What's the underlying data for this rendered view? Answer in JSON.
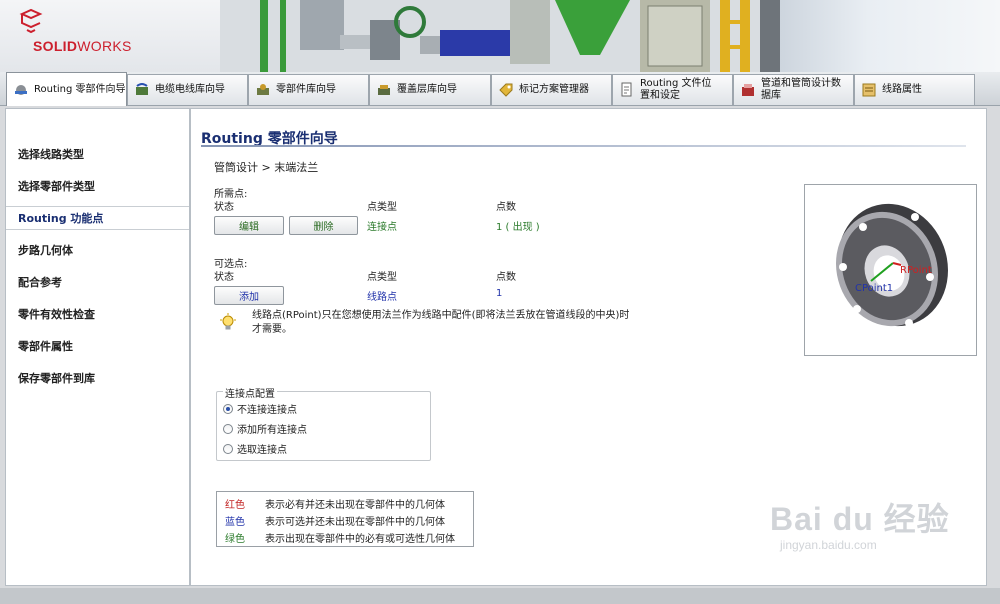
{
  "logo": {
    "brand_bold": "SOLID",
    "brand_light": "WORKS"
  },
  "tabs": [
    {
      "label": "Routing 零部件向导",
      "icon": "wizard-icon"
    },
    {
      "label": "电缆电线库向导",
      "icon": "cable-icon"
    },
    {
      "label": "零部件库向导",
      "icon": "component-icon"
    },
    {
      "label": "覆盖层库向导",
      "icon": "covering-icon"
    },
    {
      "label": "标记方案管理器",
      "icon": "tag-icon"
    },
    {
      "label": "Routing 文件位置和设定",
      "icon": "file-settings-icon"
    },
    {
      "label": "管道和管筒设计数据库",
      "icon": "database-icon"
    },
    {
      "label": "线路属性",
      "icon": "properties-icon"
    }
  ],
  "sidebar": {
    "items": [
      {
        "label": "选择线路类型"
      },
      {
        "label": "选择零部件类型"
      },
      {
        "label": "Routing 功能点"
      },
      {
        "label": "步路几何体"
      },
      {
        "label": "配合参考"
      },
      {
        "label": "零件有效性检查"
      },
      {
        "label": "零部件属性"
      },
      {
        "label": "保存零部件到库"
      }
    ]
  },
  "main": {
    "title": "Routing 零部件向导",
    "breadcrumb": "管筒设计 > 末端法兰",
    "required": {
      "section_label": "所需点:",
      "col_status": "状态",
      "col_type": "点类型",
      "col_count": "点数",
      "edit_button": "编辑",
      "delete_button": "删除",
      "point_type": "连接点",
      "point_count": "1 ( 出现 )"
    },
    "optional": {
      "section_label": "可选点:",
      "col_status": "状态",
      "col_type": "点类型",
      "col_count": "点数",
      "add_button": "添加",
      "point_type": "线路点",
      "point_count": "1"
    },
    "hint": "线路点(RPoint)只在您想使用法兰作为线路中配件(即将法兰丢放在管道线段的中央)时才需要。",
    "config": {
      "title": "连接点配置",
      "options": [
        "不连接连接点",
        "添加所有连接点",
        "选取连接点"
      ],
      "selected": 0
    },
    "legend": [
      {
        "color_name": "红色",
        "text": "表示必有并还未出现在零部件中的几何体"
      },
      {
        "color_name": "蓝色",
        "text": "表示可选并还未出现在零部件中的几何体"
      },
      {
        "color_name": "绿色",
        "text": "表示出现在零部件中的必有或可选性几何体"
      }
    ],
    "preview": {
      "label_cpoint": "CPoint1",
      "label_rpoint": "RPoint"
    }
  },
  "watermark": {
    "main": "Bai du 经验",
    "sub": "jingyan.baidu.com"
  },
  "colors": {
    "title": "#1a2f72",
    "red": "#c22222",
    "blue": "#2233aa",
    "green": "#2a7a2a"
  }
}
